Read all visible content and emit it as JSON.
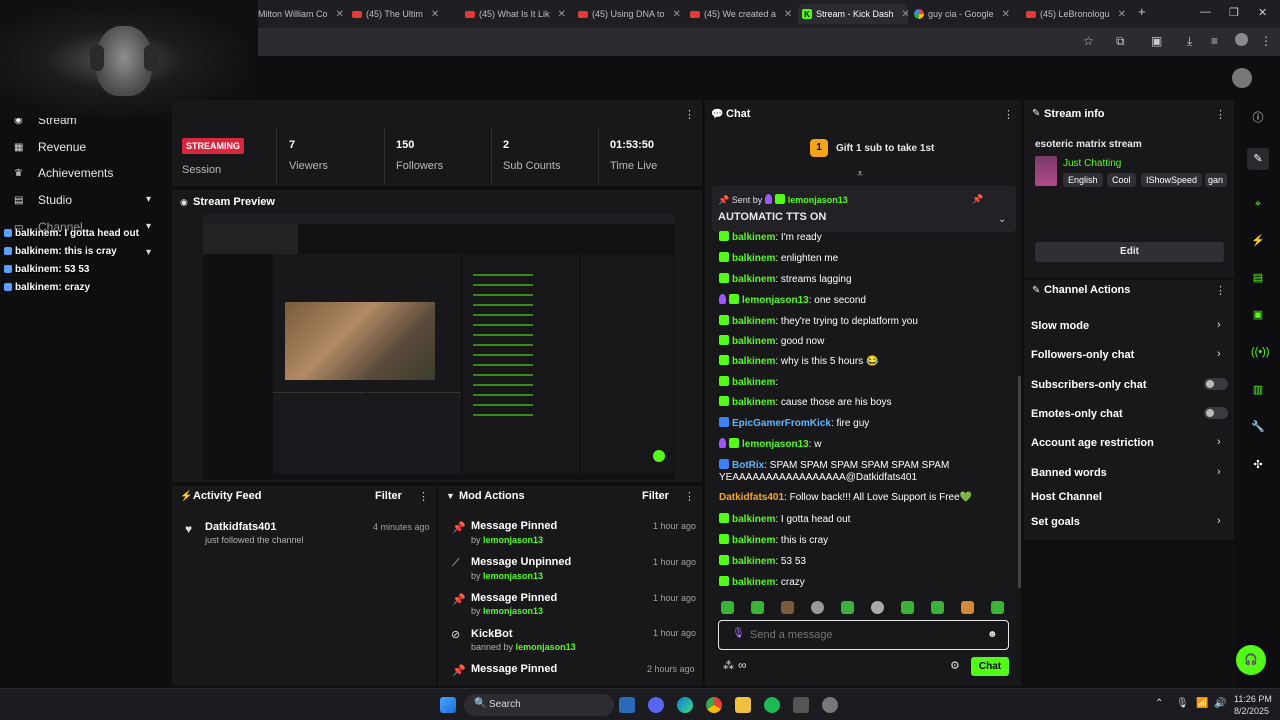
{
  "browser": {
    "tabs": [
      {
        "label": "Milton William Co",
        "type": "plain"
      },
      {
        "label": "(45) The Ultim",
        "type": "yt"
      },
      {
        "label": "(45) What Is It Lik",
        "type": "yt"
      },
      {
        "label": "(45) Using DNA to",
        "type": "yt"
      },
      {
        "label": "(45) We created a",
        "type": "yt"
      },
      {
        "label": "Stream - Kick Dash",
        "type": "kick"
      },
      {
        "label": "guy cia - Google",
        "type": "google"
      },
      {
        "label": "(45) LeBronologu",
        "type": "yt"
      }
    ],
    "new_tab": "+",
    "minimize": "—",
    "restore": "❐",
    "close": "✕"
  },
  "sidebar": {
    "items": [
      {
        "label": "Stream",
        "icon": "stream-icon"
      },
      {
        "label": "Revenue",
        "icon": "revenue-icon"
      },
      {
        "label": "Achievements",
        "icon": "trophy-icon"
      },
      {
        "label": "Studio",
        "icon": "studio-icon"
      },
      {
        "label": "Channel",
        "icon": "channel-icon"
      }
    ]
  },
  "overlay_chat": [
    {
      "user": "balkinem",
      "text": ": I gotta head out"
    },
    {
      "user": "balkinem",
      "text": ": this is cray"
    },
    {
      "user": "balkinem",
      "text": ": 53 53"
    },
    {
      "user": "balkinem",
      "text": ": crazy"
    }
  ],
  "stats": {
    "badge": "STREAMING",
    "session_label": "Session",
    "viewers": {
      "value": "7",
      "label": "Viewers"
    },
    "followers": {
      "value": "150",
      "label": "Followers"
    },
    "subs": {
      "value": "2",
      "label": "Sub Counts"
    },
    "time": {
      "value": "01:53:50",
      "label": "Time Live"
    }
  },
  "preview": {
    "title": "Stream Preview"
  },
  "activity": {
    "title": "Activity Feed",
    "filter": "Filter",
    "items": [
      {
        "user": "Datkidfats401",
        "text": "just followed the channel",
        "time": "4 minutes ago"
      }
    ]
  },
  "mod": {
    "title": "Mod Actions",
    "filter": "Filter",
    "items": [
      {
        "action": "Message Pinned",
        "prefix": "by",
        "user": "lemonjason13",
        "time": "1 hour ago"
      },
      {
        "action": "Message Unpinned",
        "prefix": "by",
        "user": "lemonjason13",
        "time": "1 hour ago"
      },
      {
        "action": "Message Pinned",
        "prefix": "by",
        "user": "lemonjason13",
        "time": "1 hour ago"
      },
      {
        "action": "KickBot",
        "prefix": "banned by",
        "user": "lemonjason13",
        "time": "1 hour ago"
      },
      {
        "action": "Message Pinned",
        "prefix": "by",
        "user": "",
        "time": "2 hours ago"
      }
    ]
  },
  "chat": {
    "title": "Chat",
    "gift_count": "1",
    "gift_text": "Gift 1 sub to take 1st",
    "pinned_sent_by": "Sent by",
    "pinned_user": "lemonjason13",
    "pinned_text": "AUTOMATIC TTS ON",
    "messages": [
      {
        "user": "balkinem",
        "text": ": I'm ready",
        "style": "g"
      },
      {
        "user": "balkinem",
        "text": ": enlighten me",
        "style": "g"
      },
      {
        "user": "balkinem",
        "text": ": streams lagging",
        "style": "g"
      },
      {
        "user": "lemonjason13",
        "text": ": one second",
        "style": "p"
      },
      {
        "user": "balkinem",
        "text": ": they're trying to deplatform you",
        "style": "g"
      },
      {
        "user": "balkinem",
        "text": ": good now",
        "style": "g"
      },
      {
        "user": "balkinem",
        "text": ": why is this 5 hours 😂",
        "style": "g"
      },
      {
        "user": "balkinem",
        "text": ":",
        "style": "g"
      },
      {
        "user": "balkinem",
        "text": ": cause those are his boys",
        "style": "g"
      },
      {
        "user": "EpicGamerFromKick",
        "text": ": fire guy",
        "style": "b"
      },
      {
        "user": "lemonjason13",
        "text": ": w",
        "style": "p"
      },
      {
        "user": "BotRix",
        "text": ": SPAM SPAM SPAM SPAM SPAM SPAM",
        "style": "b"
      },
      {
        "user": "",
        "text": "YEAAAAAAAAAAAAAAAAA@Datkidfats401",
        "style": "none"
      },
      {
        "user": "Datkidfats401",
        "text": ": Follow back!!! All Love Support is Free💚",
        "style": "o"
      },
      {
        "user": "balkinem",
        "text": ": I gotta head out",
        "style": "g"
      },
      {
        "user": "balkinem",
        "text": ": this is cray",
        "style": "g"
      },
      {
        "user": "balkinem",
        "text": ": 53 53",
        "style": "g"
      },
      {
        "user": "balkinem",
        "text": ": crazy",
        "style": "g"
      }
    ],
    "input_placeholder": "Send a message",
    "send_label": "Chat",
    "infinity": "∞"
  },
  "stream_info": {
    "title": "Stream info",
    "stream_title": "esoteric matrix stream",
    "category": "Just Chatting",
    "tags": [
      "English",
      "Cool",
      "IShowSpeed",
      "gan"
    ],
    "edit_label": "Edit"
  },
  "channel_actions": {
    "title": "Channel Actions",
    "items": [
      {
        "label": "Slow mode",
        "control": "chevron"
      },
      {
        "label": "Followers-only chat",
        "control": "chevron"
      },
      {
        "label": "Subscribers-only chat",
        "control": "toggle"
      },
      {
        "label": "Emotes-only chat",
        "control": "toggle"
      },
      {
        "label": "Account age restriction",
        "control": "chevron"
      },
      {
        "label": "Banned words",
        "control": "chevron"
      },
      {
        "label": "Host Channel",
        "control": "none"
      },
      {
        "label": "Set goals",
        "control": "chevron"
      }
    ]
  },
  "taskbar": {
    "search": "Search",
    "time": "11:26 PM",
    "date": "8/2/2025"
  },
  "colors": {
    "kick_green": "#53fc18",
    "streaming_red": "#d8263d",
    "panel": "#18181b"
  }
}
